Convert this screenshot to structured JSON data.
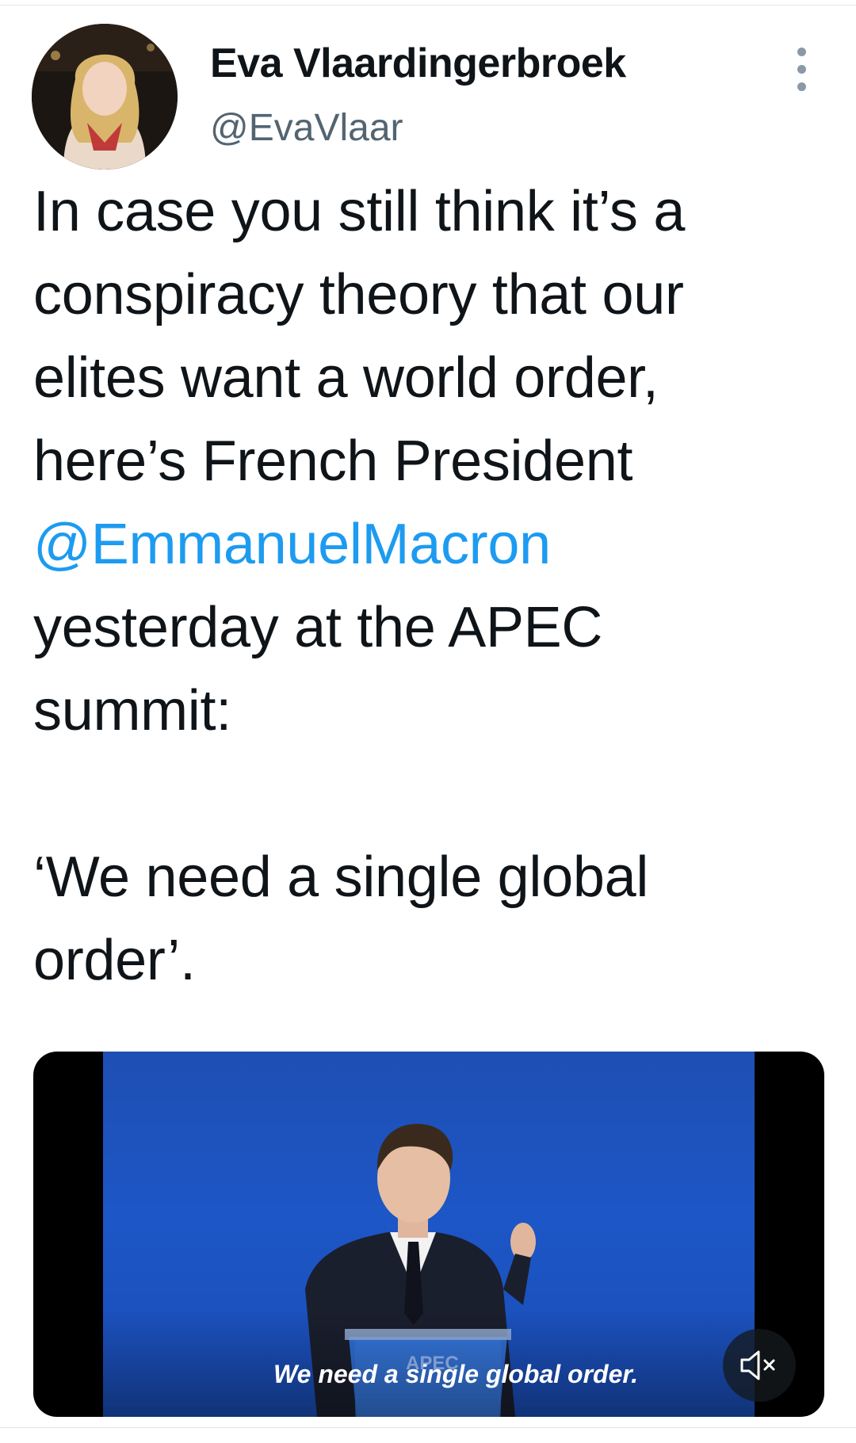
{
  "tweet": {
    "author_name": "Eva Vlaardingerbroek",
    "author_handle": "@EvaVlaar",
    "text_lines": [
      "In case you still think it’s a",
      "conspiracy theory that our",
      "elites want a world order,",
      "here’s French President"
    ],
    "mention": "@EmmanuelMacron",
    "text_lines_after": [
      "yesterday at the APEC",
      "summit:"
    ],
    "quote_lines": [
      "‘We need a single global",
      "order’."
    ]
  },
  "media": {
    "caption": "We need a single global order.",
    "podium_label": "APEC",
    "mute_icon": "speaker-muted-icon",
    "logo_icon": "bird-logo-icon"
  },
  "icons": {
    "more": "more-vertical-icon"
  },
  "colors": {
    "mention": "#1d9bf0",
    "handle": "#536471",
    "video_bg": "#1d56c6"
  }
}
